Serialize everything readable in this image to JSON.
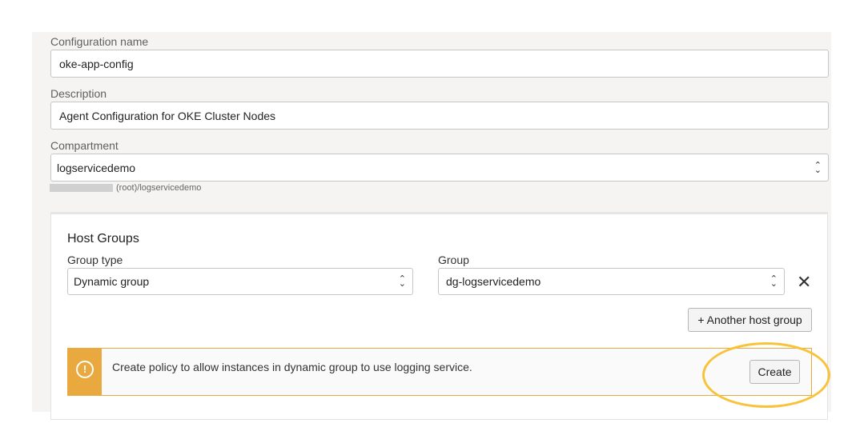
{
  "form": {
    "config_name_label": "Configuration name",
    "config_name_value": "oke-app-config",
    "description_label": "Description",
    "description_value": "Agent Configuration for OKE Cluster Nodes",
    "compartment_label": "Compartment",
    "compartment_value": "logservicedemo",
    "compartment_path": "(root)/logservicedemo"
  },
  "host_groups": {
    "title": "Host Groups",
    "group_type_label": "Group type",
    "group_type_value": "Dynamic group",
    "group_label": "Group",
    "group_value": "dg-logservicedemo",
    "add_label": "+ Another host group"
  },
  "alert": {
    "message": "Create policy to allow instances in dynamic group to use logging service.",
    "button": "Create",
    "color": "#eaa93e",
    "highlight": "#f8c33a"
  }
}
